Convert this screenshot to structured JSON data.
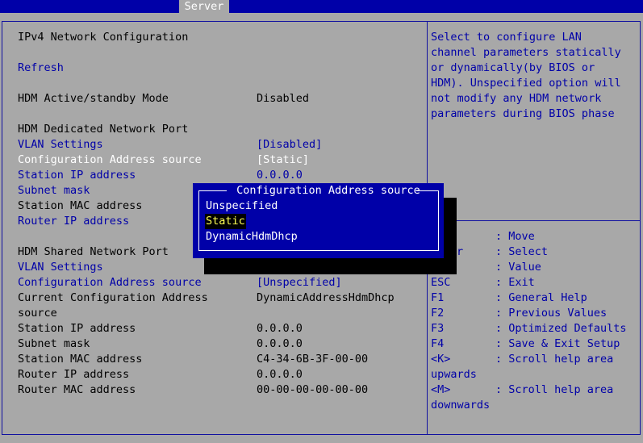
{
  "top_tab": "Server",
  "left": {
    "heading": "IPv4 Network Configuration",
    "refresh": "Refresh",
    "standby_label": "HDM Active/standby Mode",
    "standby_value": "Disabled",
    "dedicated_heading": "HDM Dedicated Network Port",
    "ded_vlan_label": "VLAN Settings",
    "ded_vlan_value": "[Disabled]",
    "ded_src_label": "Configuration Address source",
    "ded_src_value": "[Static]",
    "ded_ip_label": "Station IP address",
    "ded_ip_value": "0.0.0.0",
    "ded_mask_label": "Subnet mask",
    "ded_mac_label": "Station MAC address",
    "ded_router_label": "Router IP address",
    "shared_heading": "HDM Shared Network Port",
    "sh_vlan_label": "VLAN Settings",
    "sh_src_label": "Configuration Address source",
    "sh_src_value": "[Unspecified]",
    "sh_cur_label_1": "Current Configuration Address",
    "sh_cur_label_2": "source",
    "sh_cur_value": "DynamicAddressHdmDhcp",
    "sh_ip_label": "Station IP address",
    "sh_ip_value": "0.0.0.0",
    "sh_mask_label": "Subnet mask",
    "sh_mask_value": "0.0.0.0",
    "sh_mac_label": "Station MAC address",
    "sh_mac_value": "C4-34-6B-3F-00-00",
    "sh_router_label": "Router IP address",
    "sh_router_value": "0.0.0.0",
    "sh_rmac_label": "Router MAC address",
    "sh_rmac_value": "00-00-00-00-00-00"
  },
  "help_text": [
    "Select to configure LAN",
    "channel parameters statically",
    "or dynamically(by BIOS or",
    "HDM). Unspecified option will",
    "not modify any HDM network",
    "parameters during BIOS phase"
  ],
  "keys": [
    {
      "key": "",
      "desc": ": Move"
    },
    {
      "key": "r",
      "desc": ": Select"
    },
    {
      "key": "",
      "desc": ": Value"
    },
    {
      "key": "ESC",
      "desc": ": Exit"
    },
    {
      "key": "F1",
      "desc": ": General Help"
    },
    {
      "key": "F2",
      "desc": ": Previous Values"
    },
    {
      "key": "F3",
      "desc": ": Optimized Defaults"
    },
    {
      "key": "F4",
      "desc": ": Save & Exit Setup"
    },
    {
      "key": "<K>",
      "desc": ": Scroll help area"
    },
    {
      "key": "upwards",
      "desc": ""
    },
    {
      "key": "<M>",
      "desc": ": Scroll help area"
    },
    {
      "key": "downwards",
      "desc": ""
    }
  ],
  "popup": {
    "title": " Configuration Address source ",
    "options": [
      "Unspecified",
      "Static",
      "DynamicHdmDhcp"
    ],
    "selected": "Static"
  },
  "colors": {
    "background": "#a8a8a8",
    "bios_blue": "#0000a8",
    "highlight_text": "#ffff55"
  }
}
